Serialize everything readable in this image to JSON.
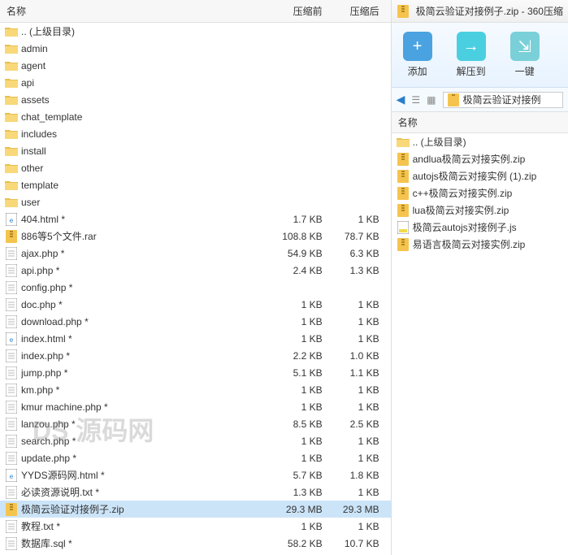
{
  "left": {
    "headers": {
      "name": "名称",
      "before": "压缩前",
      "after": "压缩后"
    },
    "rows": [
      {
        "icon": "folder",
        "name": ".. (上级目录)",
        "s1": "",
        "s2": ""
      },
      {
        "icon": "folder",
        "name": "admin",
        "s1": "",
        "s2": ""
      },
      {
        "icon": "folder",
        "name": "agent",
        "s1": "",
        "s2": ""
      },
      {
        "icon": "folder",
        "name": "api",
        "s1": "",
        "s2": ""
      },
      {
        "icon": "folder",
        "name": "assets",
        "s1": "",
        "s2": ""
      },
      {
        "icon": "folder",
        "name": "chat_template",
        "s1": "",
        "s2": ""
      },
      {
        "icon": "folder",
        "name": "includes",
        "s1": "",
        "s2": ""
      },
      {
        "icon": "folder",
        "name": "install",
        "s1": "",
        "s2": ""
      },
      {
        "icon": "folder",
        "name": "other",
        "s1": "",
        "s2": ""
      },
      {
        "icon": "folder",
        "name": "template",
        "s1": "",
        "s2": ""
      },
      {
        "icon": "folder",
        "name": "user",
        "s1": "",
        "s2": ""
      },
      {
        "icon": "html",
        "name": "404.html *",
        "s1": "1.7 KB",
        "s2": "1 KB"
      },
      {
        "icon": "rar",
        "name": "886等5个文件.rar",
        "s1": "108.8 KB",
        "s2": "78.7 KB"
      },
      {
        "icon": "php",
        "name": "ajax.php *",
        "s1": "54.9 KB",
        "s2": "6.3 KB"
      },
      {
        "icon": "php",
        "name": "api.php *",
        "s1": "2.4 KB",
        "s2": "1.3 KB"
      },
      {
        "icon": "php",
        "name": "config.php *",
        "s1": "",
        "s2": ""
      },
      {
        "icon": "php",
        "name": "doc.php *",
        "s1": "1 KB",
        "s2": "1 KB"
      },
      {
        "icon": "php",
        "name": "download.php *",
        "s1": "1 KB",
        "s2": "1 KB"
      },
      {
        "icon": "html",
        "name": "index.html *",
        "s1": "1 KB",
        "s2": "1 KB"
      },
      {
        "icon": "php",
        "name": "index.php *",
        "s1": "2.2 KB",
        "s2": "1.0 KB"
      },
      {
        "icon": "php",
        "name": "jump.php *",
        "s1": "5.1 KB",
        "s2": "1.1 KB"
      },
      {
        "icon": "php",
        "name": "km.php *",
        "s1": "1 KB",
        "s2": "1 KB"
      },
      {
        "icon": "php",
        "name": "kmur machine.php *",
        "s1": "1 KB",
        "s2": "1 KB"
      },
      {
        "icon": "php",
        "name": "lanzou.php *",
        "s1": "8.5 KB",
        "s2": "2.5 KB"
      },
      {
        "icon": "php",
        "name": "search.php *",
        "s1": "1 KB",
        "s2": "1 KB"
      },
      {
        "icon": "php",
        "name": "update.php *",
        "s1": "1 KB",
        "s2": "1 KB"
      },
      {
        "icon": "html",
        "name": "YYDS源码网.html *",
        "s1": "5.7 KB",
        "s2": "1.8 KB"
      },
      {
        "icon": "txt",
        "name": "必读资源说明.txt *",
        "s1": "1.3 KB",
        "s2": "1 KB"
      },
      {
        "icon": "zip",
        "name": "极简云验证对接例子.zip",
        "s1": "29.3 MB",
        "s2": "29.3 MB",
        "selected": true
      },
      {
        "icon": "txt",
        "name": "教程.txt *",
        "s1": "1 KB",
        "s2": "1 KB"
      },
      {
        "icon": "sql",
        "name": "数据库.sql *",
        "s1": "58.2 KB",
        "s2": "10.7 KB"
      }
    ]
  },
  "right": {
    "title": "极简云验证对接例子.zip - 360压缩",
    "toolbar": {
      "add": "添加",
      "extract": "解压到",
      "quick": "一键"
    },
    "nav_path": "极简云验证对接例",
    "header_name": "名称",
    "rows": [
      {
        "icon": "folder",
        "name": ".. (上级目录)"
      },
      {
        "icon": "zip",
        "name": "andlua极简云对接实例.zip"
      },
      {
        "icon": "zip",
        "name": "autojs极简云对接实例 (1).zip"
      },
      {
        "icon": "zip",
        "name": "c++极简云对接实例.zip"
      },
      {
        "icon": "zip",
        "name": "lua极简云对接实例.zip"
      },
      {
        "icon": "js",
        "name": "极简云autojs对接例子.js"
      },
      {
        "icon": "zip",
        "name": "易语言极简云对接实例.zip"
      }
    ]
  },
  "watermark": "DS 源码网"
}
